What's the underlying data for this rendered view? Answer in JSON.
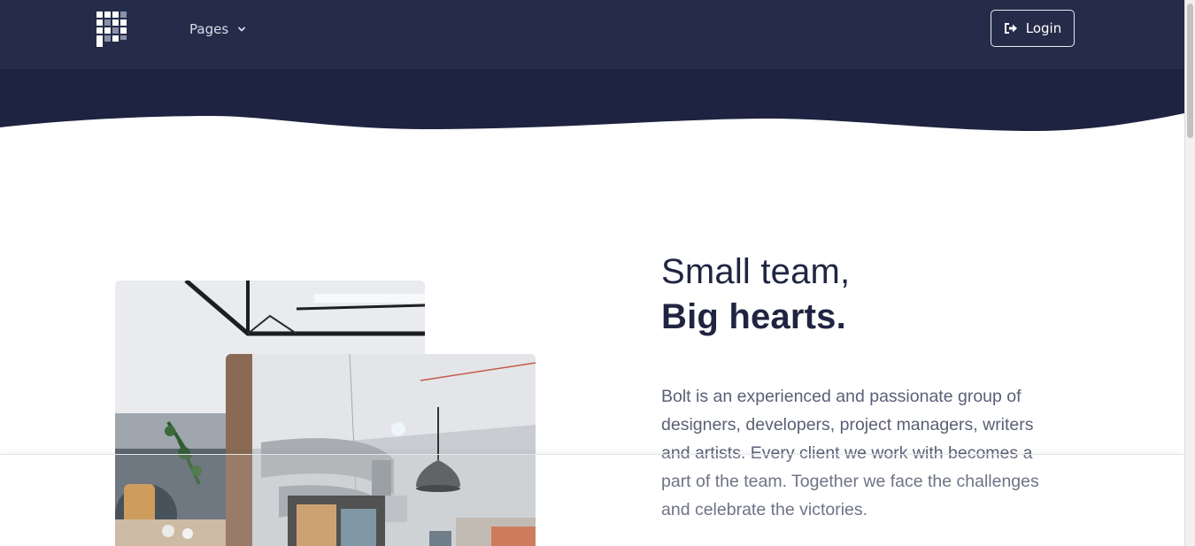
{
  "navbar": {
    "logo_name": "brand-logo",
    "pages_label": "Pages",
    "login_label": "Login"
  },
  "about": {
    "heading_line1": "Small team,",
    "heading_line2": "Big hearts.",
    "body": "Bolt is an experienced and passionate group of designers, developers, project managers, writers and artists. Every client we work with becomes a part of the team. Together we face the challenges and celebrate the victories."
  },
  "colors": {
    "navbar_bg": "#252c4a",
    "hero_bg": "#1d2340",
    "heading": "#1f2541",
    "body_text": "#5a6076"
  }
}
